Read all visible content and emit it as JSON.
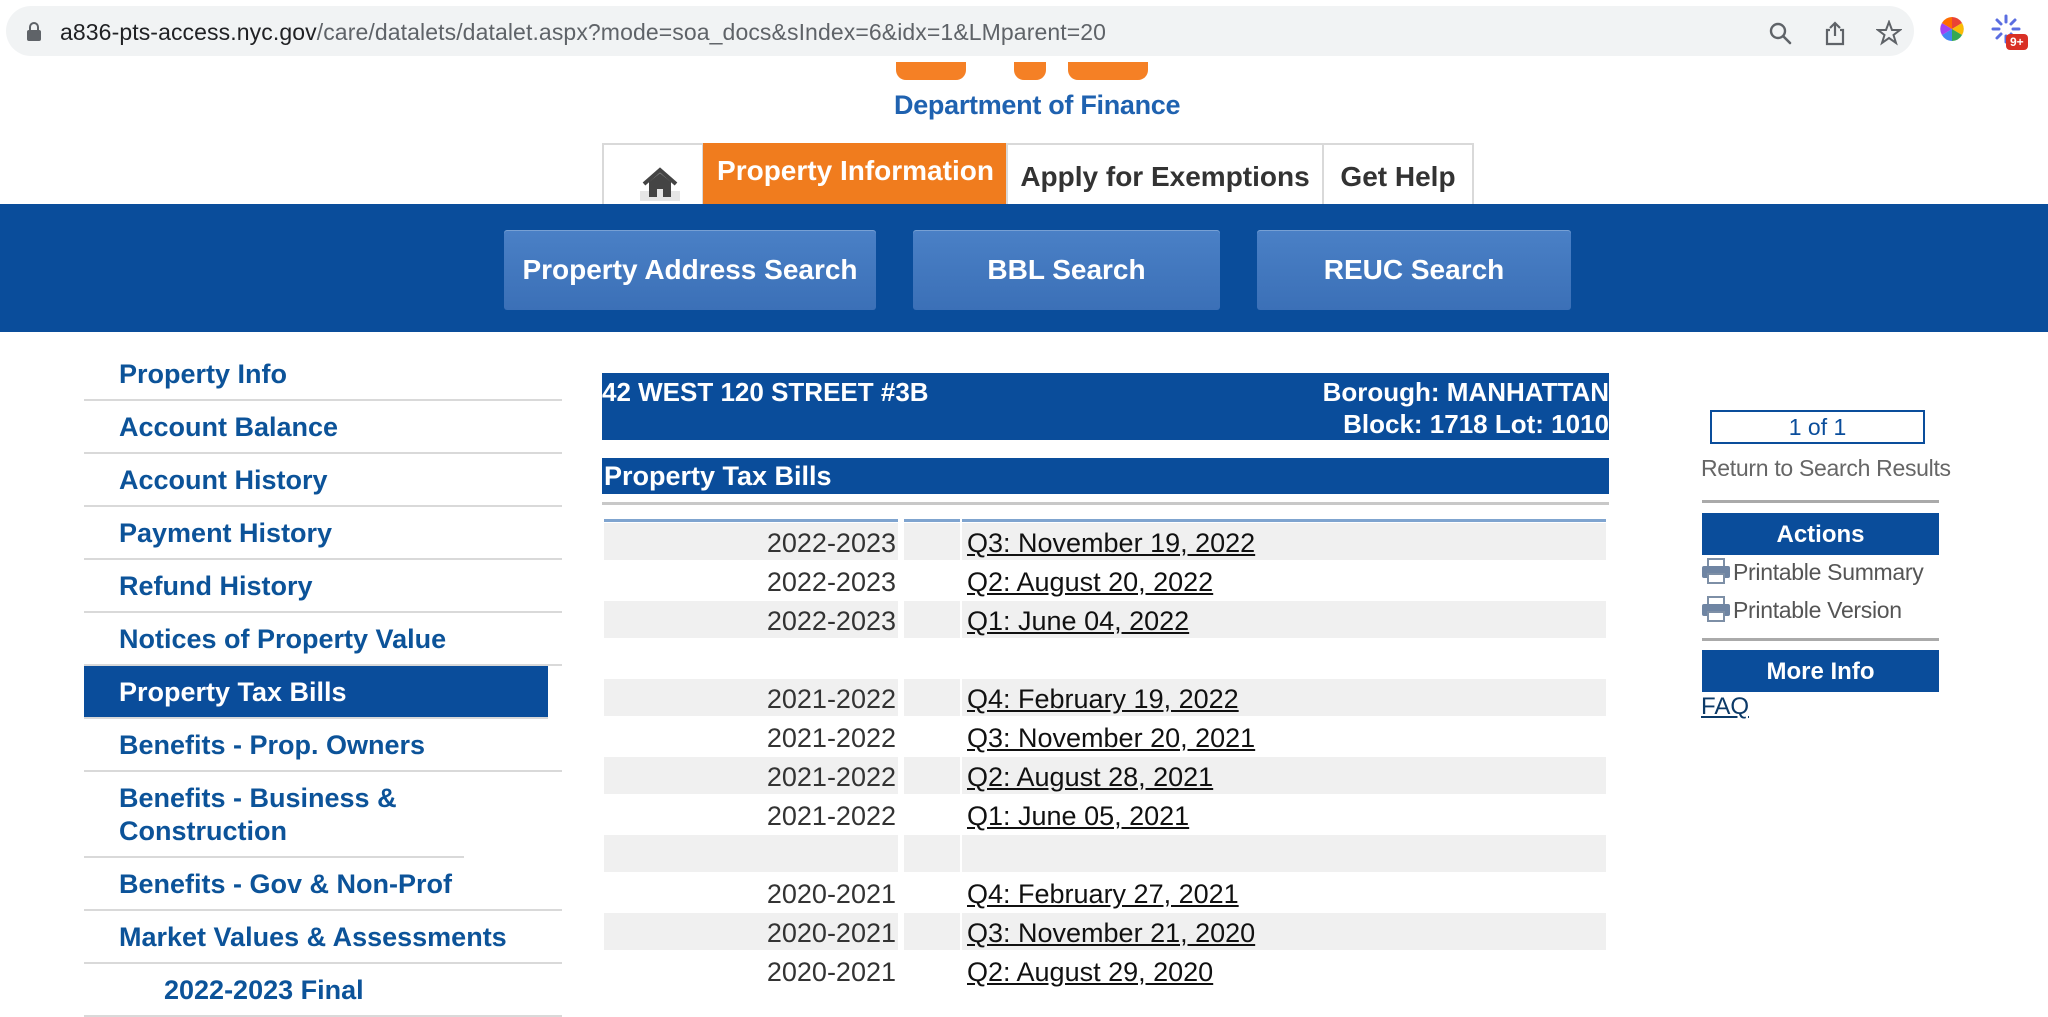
{
  "browser": {
    "url_host": "a836-pts-access.nyc.gov",
    "url_path": "/care/datalets/datalet.aspx?mode=soa_docs&sIndex=6&idx=1&LMparent=20",
    "extension_badge": "9+"
  },
  "header": {
    "department": "Department of Finance"
  },
  "tabs": [
    {
      "label": "Property Information"
    },
    {
      "label": "Apply for Exemptions"
    },
    {
      "label": "Get Help"
    }
  ],
  "search_buttons": [
    {
      "label": "Property Address Search"
    },
    {
      "label": "BBL Search"
    },
    {
      "label": "REUC Search"
    }
  ],
  "sidebar": {
    "items": [
      {
        "label": "Property Info"
      },
      {
        "label": "Account Balance"
      },
      {
        "label": "Account History"
      },
      {
        "label": "Payment History"
      },
      {
        "label": "Refund History"
      },
      {
        "label": "Notices of Property Value"
      },
      {
        "label": "Property Tax Bills"
      },
      {
        "label": "Benefits - Prop. Owners"
      },
      {
        "label": "Benefits - Business & Construction"
      },
      {
        "label": "Benefits - Gov & Non-Prof"
      },
      {
        "label": "Market Values & Assessments"
      },
      {
        "label": "2022-2023 Final"
      }
    ],
    "active_index": 6
  },
  "property": {
    "address": "42 WEST 120 STREET #3B",
    "borough": "Borough: MANHATTAN",
    "block_lot": "Block: 1718 Lot: 1010"
  },
  "section_title": "Property Tax Bills",
  "bills": [
    {
      "year": "2022-2023",
      "link": "Q3: November 19, 2022"
    },
    {
      "year": "2022-2023",
      "link": "Q2: August 20, 2022"
    },
    {
      "year": "2022-2023",
      "link": "Q1: June 04, 2022"
    },
    {
      "year": "",
      "link": ""
    },
    {
      "year": "2021-2022",
      "link": "Q4: February 19, 2022"
    },
    {
      "year": "2021-2022",
      "link": "Q3: November 20, 2021"
    },
    {
      "year": "2021-2022",
      "link": "Q2: August 28, 2021"
    },
    {
      "year": "2021-2022",
      "link": "Q1: June 05, 2021"
    },
    {
      "year": "",
      "link": ""
    },
    {
      "year": "2020-2021",
      "link": "Q4: February 27, 2021"
    },
    {
      "year": "2020-2021",
      "link": "Q3: November 21, 2020"
    },
    {
      "year": "2020-2021",
      "link": "Q2: August 29, 2020"
    }
  ],
  "right": {
    "pager": "1 of 1",
    "return_link": "Return to Search Results",
    "actions_title": "Actions",
    "printable_summary": "Printable Summary",
    "printable_version": "Printable Version",
    "more_info_title": "More Info",
    "faq": "FAQ"
  },
  "colors": {
    "brand_blue": "#0a4d9b",
    "brand_orange": "#f07c1e",
    "link_blue": "#0c5399"
  }
}
